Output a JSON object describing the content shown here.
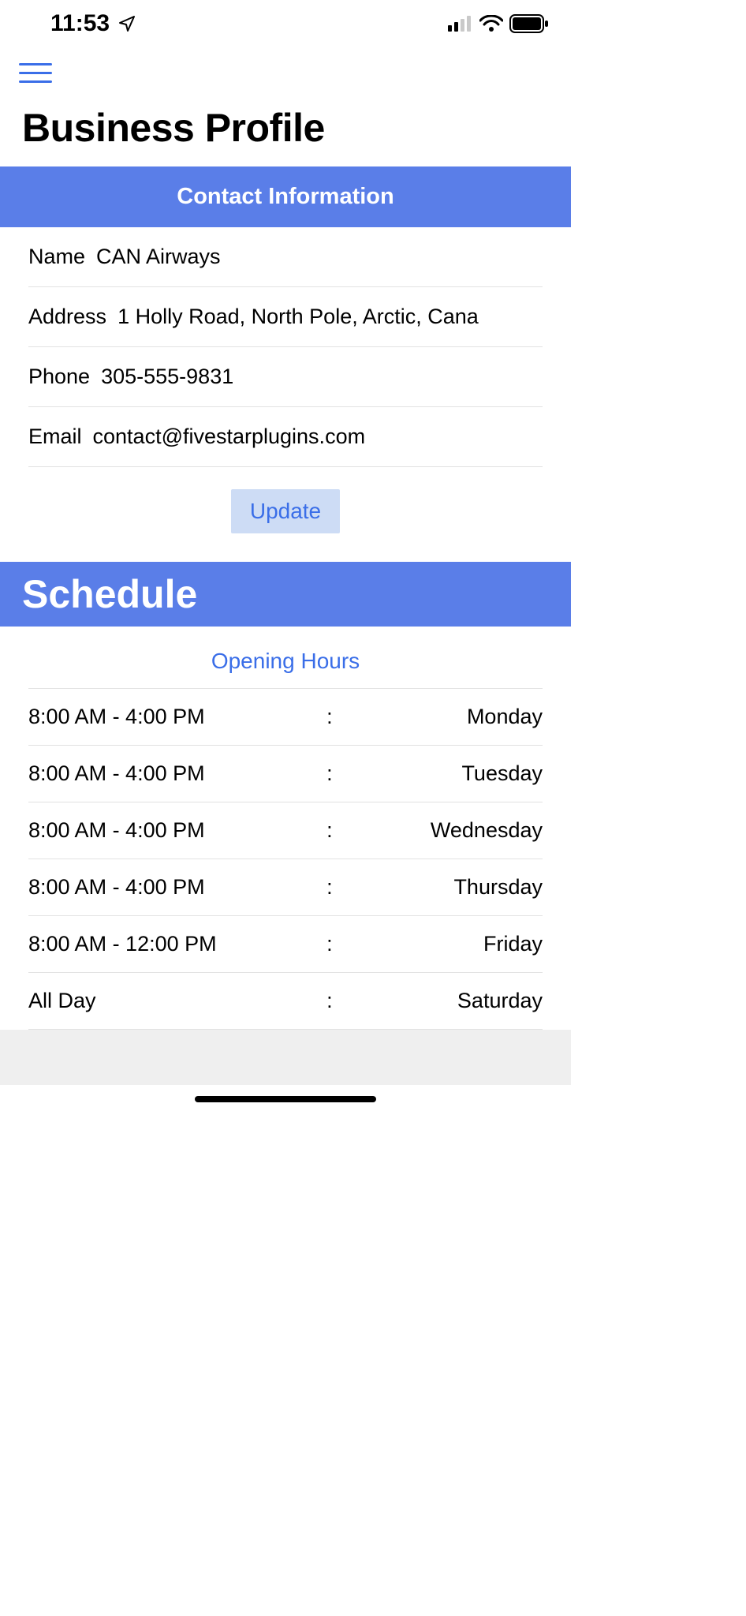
{
  "status": {
    "time": "11:53"
  },
  "page": {
    "title": "Business Profile"
  },
  "contact": {
    "header": "Contact Information",
    "name_label": "Name",
    "name_value": "CAN Airways",
    "address_label": "Address",
    "address_value": "1 Holly Road, North Pole, Arctic, Cana",
    "phone_label": "Phone",
    "phone_value": "305-555-9831",
    "email_label": "Email",
    "email_value": "contact@fivestarplugins.com",
    "update_label": "Update"
  },
  "schedule": {
    "header": "Schedule",
    "subheader": "Opening Hours",
    "rows": [
      {
        "time": "8:00 AM - 4:00 PM",
        "day": "Monday"
      },
      {
        "time": "8:00 AM - 4:00 PM",
        "day": "Tuesday"
      },
      {
        "time": "8:00 AM - 4:00 PM",
        "day": "Wednesday"
      },
      {
        "time": "8:00 AM - 4:00 PM",
        "day": "Thursday"
      },
      {
        "time": "8:00 AM - 12:00 PM",
        "day": "Friday"
      },
      {
        "time": "All Day",
        "day": "Saturday"
      }
    ],
    "colon": ":"
  }
}
